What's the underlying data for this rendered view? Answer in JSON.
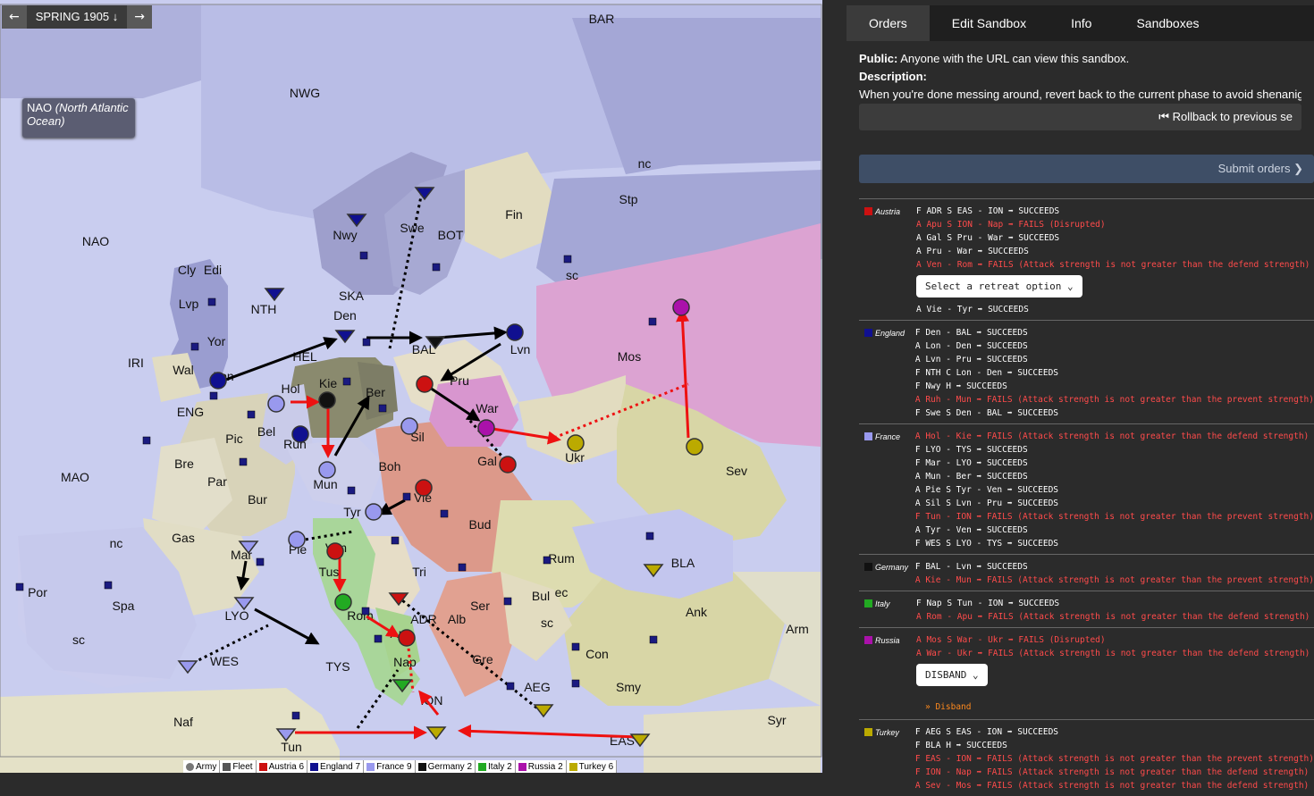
{
  "nav": {
    "back_icon": "←",
    "season": "SPRING 1905",
    "season_icon": "↓",
    "forward_icon": "→"
  },
  "tooltip": {
    "abbr": "NAO",
    "full": "(North Atlantic Ocean)"
  },
  "map_labels": [
    "BAR",
    "NWG",
    "NAO",
    "nc",
    "Stp",
    "Fin",
    "BOT",
    "Swe",
    "Nwy",
    "Cly",
    "Edi",
    "Lvp",
    "NTH",
    "SKA",
    "sc",
    "Yor",
    "Den",
    "BAL",
    "Lvn",
    "Mos",
    "IRI",
    "Wal",
    "Lon",
    "HEL",
    "Kie",
    "Ber",
    "Pru",
    "Hol",
    "ENG",
    "Bel",
    "Ruh",
    "Sil",
    "War",
    "Pic",
    "Gal",
    "Ukr",
    "Sev",
    "Bre",
    "Par",
    "Mun",
    "Boh",
    "MAO",
    "Bur",
    "Vie",
    "Tyr",
    "Bud",
    "Gas",
    "Pie",
    "Ven",
    "Mar",
    "nc",
    "Rum",
    "BLA",
    "Por",
    "Spa",
    "Tri",
    "Tus",
    "Bul",
    "ec",
    "LYO",
    "Rom",
    "ADR",
    "Alb",
    "Ser",
    "sc",
    "Ank",
    "Arm",
    "sc",
    "WES",
    "Apu",
    "TYS",
    "Nap",
    "Gre",
    "Con",
    "AEG",
    "Smy",
    "ION",
    "Naf",
    "Syr",
    "EAS",
    "Tun"
  ],
  "legend": [
    {
      "label": "Army",
      "color": "#777"
    },
    {
      "label": "Fleet",
      "color": "#555"
    },
    {
      "label": "Austria 6",
      "color": "#cc1111"
    },
    {
      "label": "England 7",
      "color": "#101090"
    },
    {
      "label": "France 9",
      "color": "#9999ee"
    },
    {
      "label": "Germany 2",
      "color": "#111111"
    },
    {
      "label": "Italy 2",
      "color": "#22aa22"
    },
    {
      "label": "Russia 2",
      "color": "#aa11aa"
    },
    {
      "label": "Turkey 6",
      "color": "#bbaa00"
    }
  ],
  "tabs": [
    "Orders",
    "Edit Sandbox",
    "Info",
    "Sandboxes"
  ],
  "info": {
    "public_label": "Public:",
    "public_text": "Anyone with the URL can view this sandbox.",
    "description_label": "Description:",
    "description_text": "When you're done messing around, revert back to the current phase to avoid shenanigan",
    "rollback": "⏮ Rollback to previous se"
  },
  "submit": "Submit orders ❯",
  "powers": [
    {
      "name": "Austria",
      "color": "#cc1111",
      "orders": [
        {
          "t": "F ADR S EAS - ION ➡ SUCCEEDS",
          "fail": false
        },
        {
          "t": "A Apu S ION - Nap ➡ FAILS (Disrupted)",
          "fail": true
        },
        {
          "t": "A Gal S Pru - War ➡ SUCCEEDS",
          "fail": false
        },
        {
          "t": "A Pru - War ➡ SUCCEEDS",
          "fail": false
        },
        {
          "t": "A Ven - Rom ➡ FAILS (Attack strength is not greater than the defend strength)",
          "fail": true
        },
        {
          "select": "Select a retreat option ⌄"
        },
        {
          "t": "A Vie - Tyr ➡ SUCCEEDS",
          "fail": false
        }
      ]
    },
    {
      "name": "England",
      "color": "#101090",
      "orders": [
        {
          "t": "F Den - BAL ➡ SUCCEEDS",
          "fail": false
        },
        {
          "t": "A Lon - Den ➡ SUCCEEDS",
          "fail": false
        },
        {
          "t": "A Lvn - Pru ➡ SUCCEEDS",
          "fail": false
        },
        {
          "t": "F NTH C Lon - Den ➡ SUCCEEDS",
          "fail": false
        },
        {
          "t": "F Nwy H ➡ SUCCEEDS",
          "fail": false
        },
        {
          "t": "A Ruh - Mun ➡ FAILS (Attack strength is not greater than the prevent strength)",
          "fail": true
        },
        {
          "t": "F Swe S Den - BAL ➡ SUCCEEDS",
          "fail": false
        }
      ]
    },
    {
      "name": "France",
      "color": "#9999ee",
      "orders": [
        {
          "t": "A Hol - Kie ➡ FAILS (Attack strength is not greater than the defend strength)",
          "fail": true
        },
        {
          "t": "F LYO - TYS ➡ SUCCEEDS",
          "fail": false
        },
        {
          "t": "F Mar - LYO ➡ SUCCEEDS",
          "fail": false
        },
        {
          "t": "A Mun - Ber ➡ SUCCEEDS",
          "fail": false
        },
        {
          "t": "A Pie S Tyr - Ven ➡ SUCCEEDS",
          "fail": false
        },
        {
          "t": "A Sil S Lvn - Pru ➡ SUCCEEDS",
          "fail": false
        },
        {
          "t": "F Tun - ION ➡ FAILS (Attack strength is not greater than the prevent strength)",
          "fail": true
        },
        {
          "t": "A Tyr - Ven ➡ SUCCEEDS",
          "fail": false
        },
        {
          "t": "F WES S LYO - TYS ➡ SUCCEEDS",
          "fail": false
        }
      ]
    },
    {
      "name": "Germany",
      "color": "#111111",
      "orders": [
        {
          "t": "F BAL - Lvn ➡ SUCCEEDS",
          "fail": false
        },
        {
          "t": "A Kie - Mun ➡ FAILS (Attack strength is not greater than the prevent strength)",
          "fail": true
        }
      ]
    },
    {
      "name": "Italy",
      "color": "#22aa22",
      "orders": [
        {
          "t": "F Nap S Tun - ION ➡ SUCCEEDS",
          "fail": false
        },
        {
          "t": "A Rom - Apu ➡ FAILS (Attack strength is not greater than the defend strength)",
          "fail": true
        }
      ]
    },
    {
      "name": "Russia",
      "color": "#aa11aa",
      "orders": [
        {
          "t": "A Mos S War - Ukr ➡ FAILS (Disrupted)",
          "fail": true
        },
        {
          "t": "A War - Ukr ➡ FAILS (Attack strength is not greater than the defend strength)",
          "fail": true
        },
        {
          "select": "DISBAND ⌄"
        },
        {
          "disband": "» Disband"
        }
      ]
    },
    {
      "name": "Turkey",
      "color": "#bbaa00",
      "orders": [
        {
          "t": "F AEG S EAS - ION ➡ SUCCEEDS",
          "fail": false
        },
        {
          "t": "F BLA H ➡ SUCCEEDS",
          "fail": false
        },
        {
          "t": "F EAS - ION ➡ FAILS (Attack strength is not greater than the prevent strength)",
          "fail": true
        },
        {
          "t": "F ION - Nap ➡ FAILS (Attack strength is not greater than the defend strength)",
          "fail": true
        },
        {
          "t": "A Sev - Mos ➡ FAILS (Attack strength is not greater than the defend strength)",
          "fail": true
        }
      ]
    }
  ]
}
